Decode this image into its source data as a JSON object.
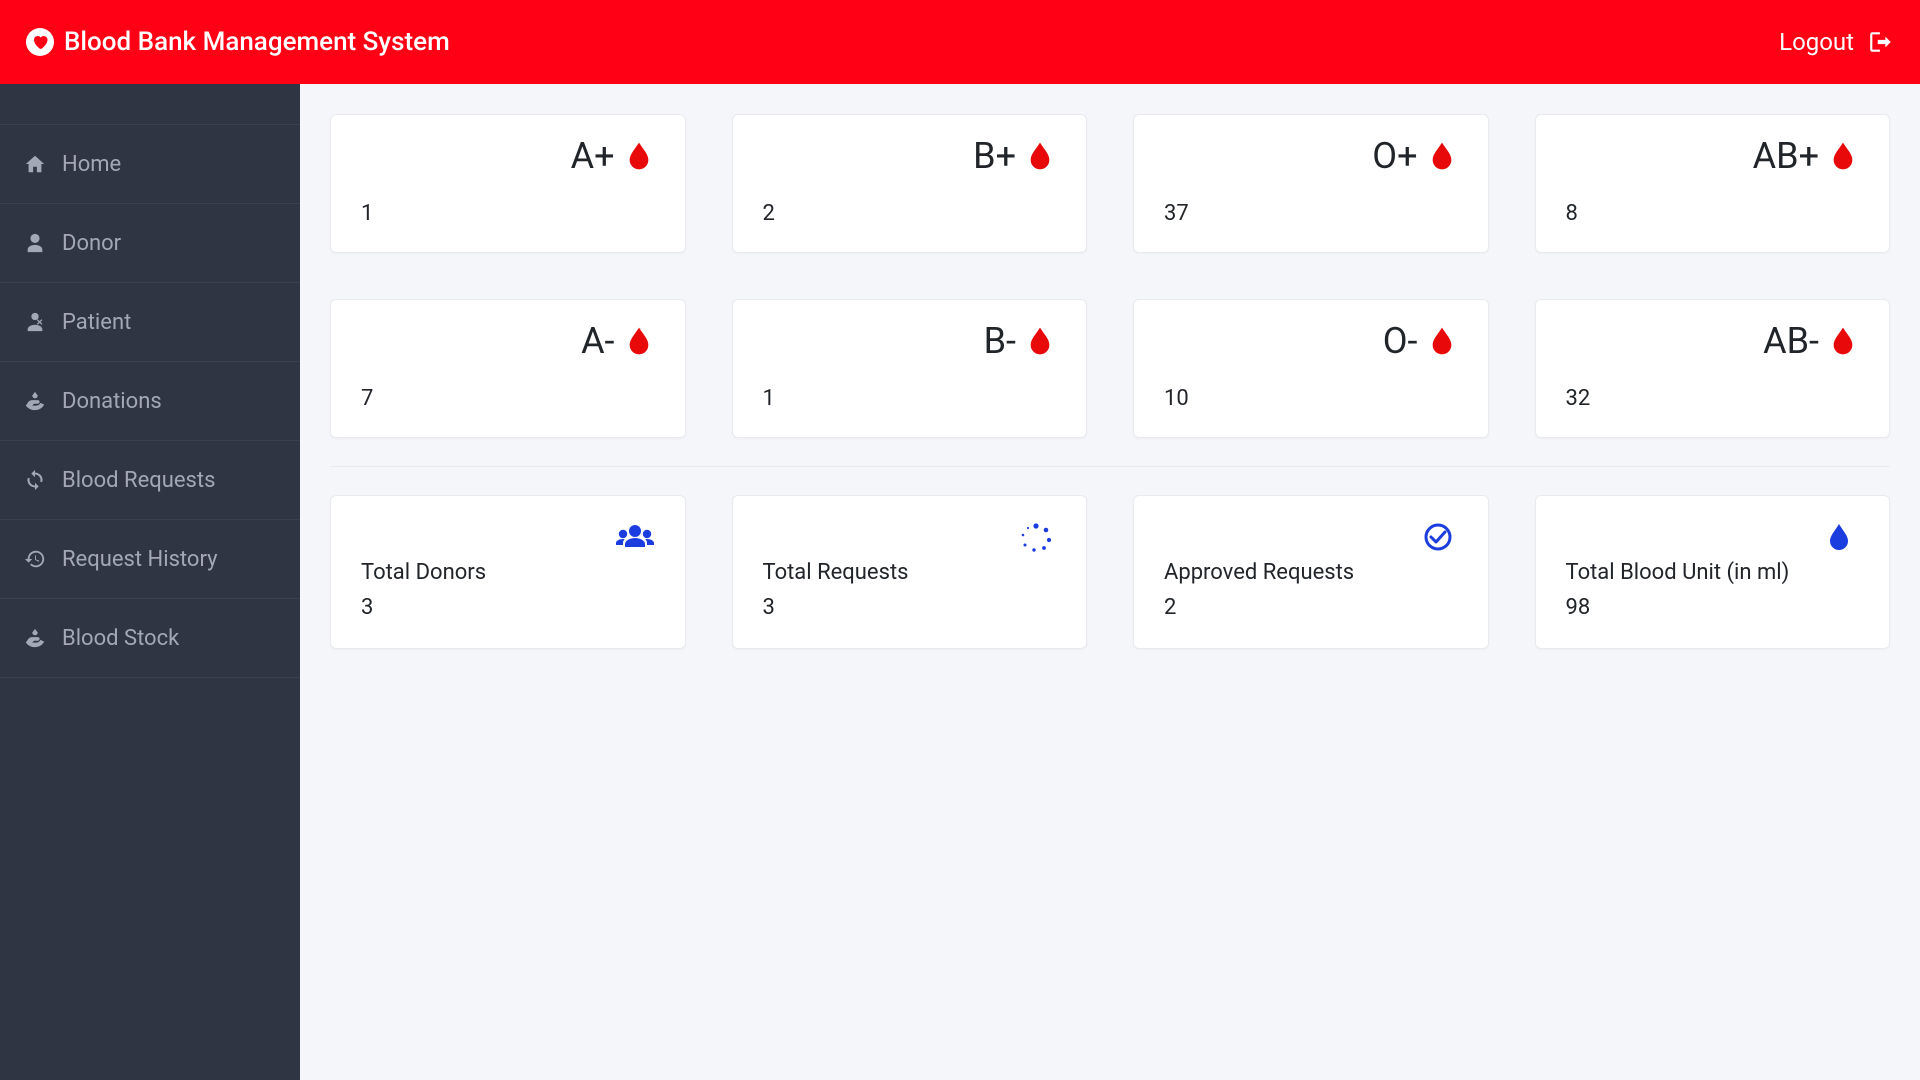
{
  "header": {
    "title": "Blood Bank Management System",
    "logout_label": "Logout"
  },
  "sidebar": {
    "items": [
      {
        "label": "Home"
      },
      {
        "label": "Donor"
      },
      {
        "label": "Patient"
      },
      {
        "label": "Donations"
      },
      {
        "label": "Blood Requests"
      },
      {
        "label": "Request History"
      },
      {
        "label": "Blood Stock"
      }
    ]
  },
  "blood_groups": [
    {
      "type": "A+",
      "value": "1"
    },
    {
      "type": "B+",
      "value": "2"
    },
    {
      "type": "O+",
      "value": "37"
    },
    {
      "type": "AB+",
      "value": "8"
    },
    {
      "type": "A-",
      "value": "7"
    },
    {
      "type": "B-",
      "value": "1"
    },
    {
      "type": "O-",
      "value": "10"
    },
    {
      "type": "AB-",
      "value": "32"
    }
  ],
  "stats": [
    {
      "label": "Total Donors",
      "value": "3",
      "icon": "users"
    },
    {
      "label": "Total Requests",
      "value": "3",
      "icon": "spinner"
    },
    {
      "label": "Approved Requests",
      "value": "2",
      "icon": "check-circle"
    },
    {
      "label": "Total Blood Unit (in ml)",
      "value": "98",
      "icon": "drop-blue"
    }
  ],
  "colors": {
    "accent_red": "#ff0015",
    "accent_blue": "#1b3de0",
    "sidebar_bg": "#2f3542"
  }
}
